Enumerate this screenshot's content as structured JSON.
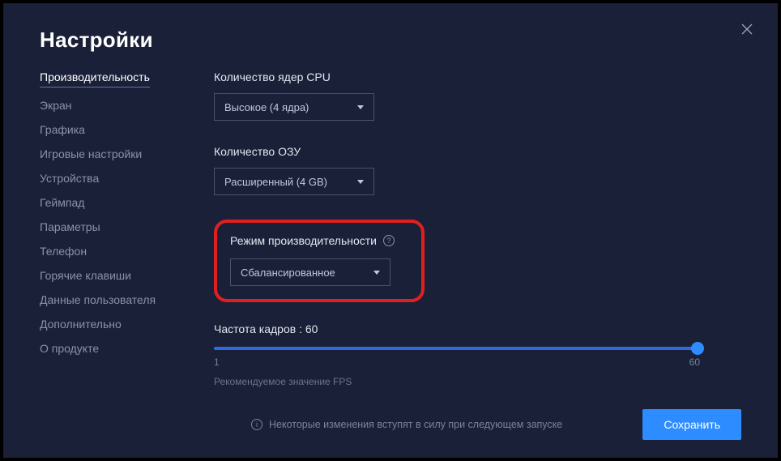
{
  "title": "Настройки",
  "sidebar": {
    "items": [
      {
        "label": "Производительность"
      },
      {
        "label": "Экран"
      },
      {
        "label": "Графика"
      },
      {
        "label": "Игровые настройки"
      },
      {
        "label": "Устройства"
      },
      {
        "label": "Геймпад"
      },
      {
        "label": "Параметры"
      },
      {
        "label": "Телефон"
      },
      {
        "label": "Горячие клавиши"
      },
      {
        "label": "Данные пользователя"
      },
      {
        "label": "Дополнительно"
      },
      {
        "label": "О продукте"
      }
    ]
  },
  "cpu": {
    "label": "Количество ядер CPU",
    "value": "Высокое (4 ядра)"
  },
  "ram": {
    "label": "Количество ОЗУ",
    "value": "Расширенный (4 GB)"
  },
  "perf": {
    "label": "Режим производительности",
    "value": "Сбалансированное"
  },
  "fps": {
    "label": "Частота кадров : 60",
    "min": "1",
    "max": "60",
    "note": "Рекомендуемое значение FPS"
  },
  "footer": {
    "note": "Некоторые изменения вступят в силу при следующем запуске",
    "save": "Сохранить"
  }
}
